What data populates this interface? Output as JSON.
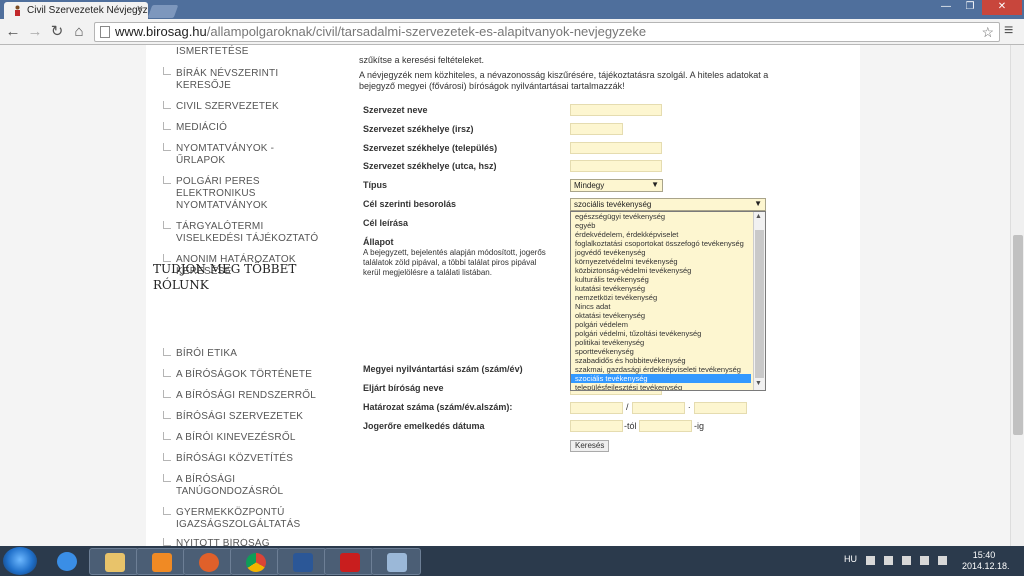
{
  "browser": {
    "tab_title": "Civil Szervezetek Névjegyz",
    "tab_close": "×",
    "url_host": "www.birosag.hu",
    "url_path": "/allampolgaroknak/civil/tarsadalmi-szervezetek-es-alapitvanyok-nevjegyzeke"
  },
  "sidebar": {
    "items": [
      {
        "line1": "ISMERTETÉSE",
        "line2": "",
        "line3": ""
      },
      {
        "line1": "BÍRÁK NÉVSZERINTI",
        "line2": "KERESŐJE",
        "line3": ""
      },
      {
        "line1": "CIVIL SZERVEZETEK",
        "line2": "",
        "line3": ""
      },
      {
        "line1": "MEDIÁCIÓ",
        "line2": "",
        "line3": ""
      },
      {
        "line1": "NYOMTATVÁNYOK -",
        "line2": "ŰRLAPOK",
        "line3": ""
      },
      {
        "line1": "POLGÁRI PERES",
        "line2": "ELEKTRONIKUS",
        "line3": "NYOMTATVÁNYOK"
      },
      {
        "line1": "TÁRGYALÓTERMI",
        "line2": "VISELKEDÉSI TÁJÉKOZTATÓ",
        "line3": ""
      },
      {
        "line1": "ANONIM HATÁROZATOK",
        "line2": "KERESÉSE",
        "line3": ""
      }
    ],
    "heading_line1": "TUDJON MEG TÖBBET",
    "heading_line2": "RÓLUNK",
    "more_items": [
      {
        "line1": "BÍRÓI ETIKA",
        "line2": ""
      },
      {
        "line1": "A BÍRÓSÁGOK TÖRTÉNETE",
        "line2": ""
      },
      {
        "line1": "A BÍRÓSÁGI RENDSZERRŐL",
        "line2": ""
      },
      {
        "line1": "BÍRÓSÁGI SZERVEZETEK",
        "line2": ""
      },
      {
        "line1": "A BÍRÓI KINEVEZÉSRŐL",
        "line2": ""
      },
      {
        "line1": "BÍRÓSÁGI KÖZVETÍTÉS",
        "line2": ""
      },
      {
        "line1": "A BÍRÓSÁGI",
        "line2": "TANÚGONDOZÁSRÓL"
      },
      {
        "line1": "GYERMEKKÖZPONTÚ",
        "line2": "IGAZSÁGSZOLGÁLTATÁS"
      },
      {
        "line1": "NYITOTT BÍRÓSÁG",
        "line2": ""
      }
    ]
  },
  "main": {
    "intro_line1": "szűkítse a keresési feltételeket.",
    "intro_line2": "A névjegyzék nem közhiteles, a névazonosság kiszűrésére, tájékoztatásra szolgál. A hiteles adatokat a",
    "intro_line3": "bejegyző megyei (fővárosi) bíróságok nyilvántartásai tartalmazzák!",
    "labels": {
      "name": "Szervezet neve",
      "hq_plot": "Szervezet székhelye (irsz)",
      "hq_city": "Szervezet székhelye (település)",
      "hq_street": "Szervezet székhelye (utca, hsz)",
      "type": "Típus",
      "goal": "Cél szerinti besorolás",
      "goal_desc": "Cél leírása",
      "status": "Állapot",
      "county_no": "Megyei nyilvántartási szám (szám/év)",
      "court": "Eljárt bíróság neve",
      "decision_no": "Határozat száma (szám/év.alszám):",
      "legal_date": "Jogerőre emelkedés dátuma"
    },
    "status_text_line1": "A bejegyzett, bejelentés alapján módosított, jogerős",
    "status_text_line2": "találatok zöld pipával, a többi találat piros pipával",
    "status_text_line3": "kerül megjelölésre a találati listában.",
    "type_value": "Mindegy",
    "goal_value": "szociális tevékenység",
    "from_suffix": "-tól",
    "to_suffix": "-ig",
    "slash": "/",
    "dot": ".",
    "search_button": "Keresés",
    "dropdown_options": [
      "egészségügyi tevékenység",
      "egyéb",
      "érdekvédelem, érdekképviselet",
      "foglalkoztatási csoportokat összefogó tevékenység",
      "jogvédő tevékenység",
      "környezetvédelmi tevékenység",
      "közbiztonság-védelmi tevékenység",
      "kulturális tevékenység",
      "kutatási tevékenység",
      "nemzetközi tevékenység",
      "Nincs adat",
      "oktatási tevékenység",
      "polgári védelem",
      "polgári védelmi, tűzoltási tevékenység",
      "politikai tevékenység",
      "sporttevékenység",
      "szabadidős és hobbitevékenység",
      "szakmai, gazdasági érdekképviseleti tevékenység",
      "szociális tevékenység",
      "településfejlesztési tevékenység"
    ],
    "selected_option_index": 18
  },
  "taskbar": {
    "language": "HU",
    "time": "15:40",
    "date": "2014.12.18."
  },
  "colors": {
    "field_bg": "#fdf6d0",
    "selection": "#3399ff",
    "taskbar": "#2b3a4c"
  }
}
